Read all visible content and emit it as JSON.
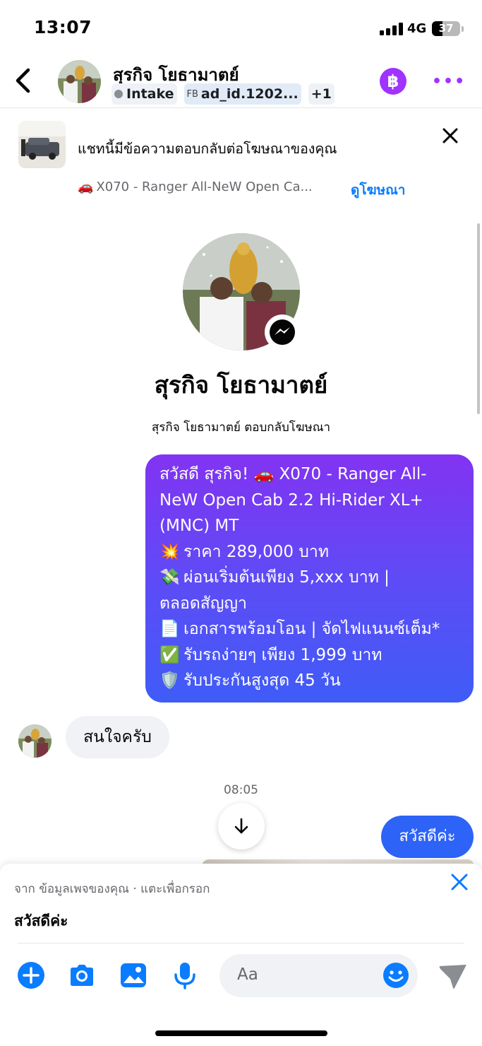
{
  "status_bar": {
    "time": "13:07",
    "network": "4G",
    "battery": "37",
    "battery_level": 0.37
  },
  "header": {
    "contact_name": "สุรกิจ โยธามาตย์",
    "tags": {
      "status": "Intake",
      "fb_prefix": "FB",
      "ad_id": "ad_id.1202...",
      "extra": "+1"
    },
    "coin_label": "฿",
    "more_label": "•••"
  },
  "ad_banner": {
    "text": "แชทนี้มีข้อความตอบกลับต่อโฆษณาของคุณ",
    "car_emoji": "🚗",
    "ad_title": "X070 - Ranger All-NeW Open Ca...",
    "view_ad": "ดูโฆษณา"
  },
  "profile": {
    "name": "สุรกิจ โยธามาตย์",
    "subtitle": "สุรกิจ โยธามาตย์ ตอบกลับโฆษณา"
  },
  "messages": {
    "outgoing_1": [
      {
        "emoji": "",
        "text": "สวัสดี สุรกิจ! 🚗 X070 - Ranger All-"
      },
      {
        "emoji": "",
        "text": "NeW Open Cab 2.2 Hi-Rider XL+"
      },
      {
        "emoji": "",
        "text": "(MNC) MT"
      },
      {
        "emoji": "💥",
        "text": "ราคา 289,000 บาท"
      },
      {
        "emoji": "💸",
        "text": "ผ่อนเริ่มต้นเพียง 5,xxx บาท |"
      },
      {
        "emoji": "",
        "text": "ตลอดสัญญา"
      },
      {
        "emoji": "📄",
        "text": "เอกสารพร้อมโอน | จัดไฟแนนซ์เต็ม*"
      },
      {
        "emoji": "✅",
        "text": "รับรถง่ายๆ เพียง 1,999 บาท"
      },
      {
        "emoji": "🛡️",
        "text": "รับประกันสูงสุด 45 วัน"
      }
    ],
    "incoming_1": "สนใจครับ",
    "timestamp": "08:05",
    "outgoing_2": "สวัสดีค่ะ"
  },
  "suggestion": {
    "label": "จาก ข้อมูลเพจของคุณ · แตะเพื่อกรอก",
    "text": "สวัสดีค่ะ"
  },
  "composer": {
    "placeholder": "Aa"
  },
  "colors": {
    "accent_blue": "#0a7cff",
    "accent_purple": "#a033ff",
    "bubble_gradient_start": "#8233f2",
    "bubble_gradient_end": "#3f5cf7",
    "bubble_blue": "#2d63f6"
  }
}
